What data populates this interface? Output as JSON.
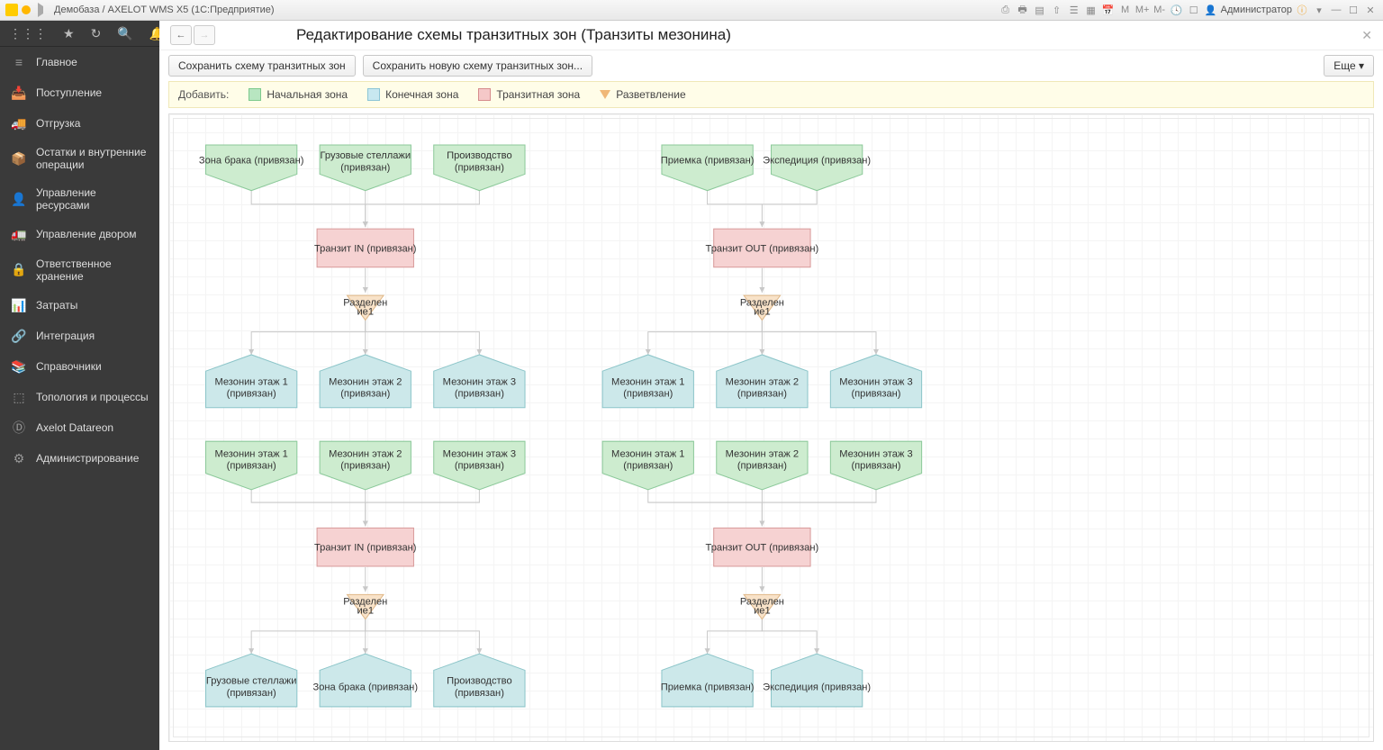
{
  "titlebar": {
    "text": "Демобаза / AXELOT WMS X5  (1С:Предприятие)",
    "user": "Администратор"
  },
  "sidebar": {
    "items": [
      {
        "icon": "menu",
        "label": "Главное"
      },
      {
        "icon": "in",
        "label": "Поступление"
      },
      {
        "icon": "out",
        "label": "Отгрузка"
      },
      {
        "icon": "box",
        "label": "Остатки и внутренние операции"
      },
      {
        "icon": "person",
        "label": "Управление ресурсами"
      },
      {
        "icon": "truck",
        "label": "Управление двором"
      },
      {
        "icon": "lock",
        "label": "Ответственное хранение"
      },
      {
        "icon": "chart",
        "label": "Затраты"
      },
      {
        "icon": "link",
        "label": "Интеграция"
      },
      {
        "icon": "book",
        "label": "Справочники"
      },
      {
        "icon": "flow",
        "label": "Топология и процессы"
      },
      {
        "icon": "d",
        "label": "Axelot Datareon"
      },
      {
        "icon": "gear",
        "label": "Администрирование"
      }
    ]
  },
  "header": {
    "title": "Редактирование схемы транзитных зон (Транзиты мезонина)"
  },
  "toolbar": {
    "save": "Сохранить схему транзитных зон",
    "save_new": "Сохранить новую схему транзитных зон...",
    "more": "Еще"
  },
  "addbar": {
    "label": "Добавить:",
    "start": "Начальная зона",
    "end": "Конечная зона",
    "transit": "Транзитная зона",
    "branch": "Разветвление"
  },
  "diagram": {
    "start_nodes_left": [
      {
        "l1": "Зона брака (привязан)"
      },
      {
        "l1": "Грузовые стеллажи",
        "l2": "(привязан)"
      },
      {
        "l1": "Производство",
        "l2": "(привязан)"
      }
    ],
    "start_nodes_right": [
      {
        "l1": "Приемка (привязан)"
      },
      {
        "l1": "Экспедиция (привязан)"
      }
    ],
    "transit_in": "Транзит IN (привязан)",
    "transit_out": "Транзит OUT (привязан)",
    "branch": "Разделен",
    "branch_sub": "ие1",
    "mez_blue": [
      {
        "l1": "Мезонин этаж 1",
        "l2": "(привязан)"
      },
      {
        "l1": "Мезонин этаж 2",
        "l2": "(привязан)"
      },
      {
        "l1": "Мезонин этаж 3",
        "l2": "(привязан)"
      }
    ],
    "mez_green": [
      {
        "l1": "Мезонин этаж 1",
        "l2": "(привязан)"
      },
      {
        "l1": "Мезонин этаж 2",
        "l2": "(привязан)"
      },
      {
        "l1": "Мезонин этаж 3",
        "l2": "(привязан)"
      }
    ],
    "end_left": [
      {
        "l1": "Грузовые стеллажи",
        "l2": "(привязан)"
      },
      {
        "l1": "Зона брака (привязан)"
      },
      {
        "l1": "Производство",
        "l2": "(привязан)"
      }
    ],
    "end_right": [
      {
        "l1": "Приемка (привязан)"
      },
      {
        "l1": "Экспедиция (привязан)"
      }
    ]
  }
}
